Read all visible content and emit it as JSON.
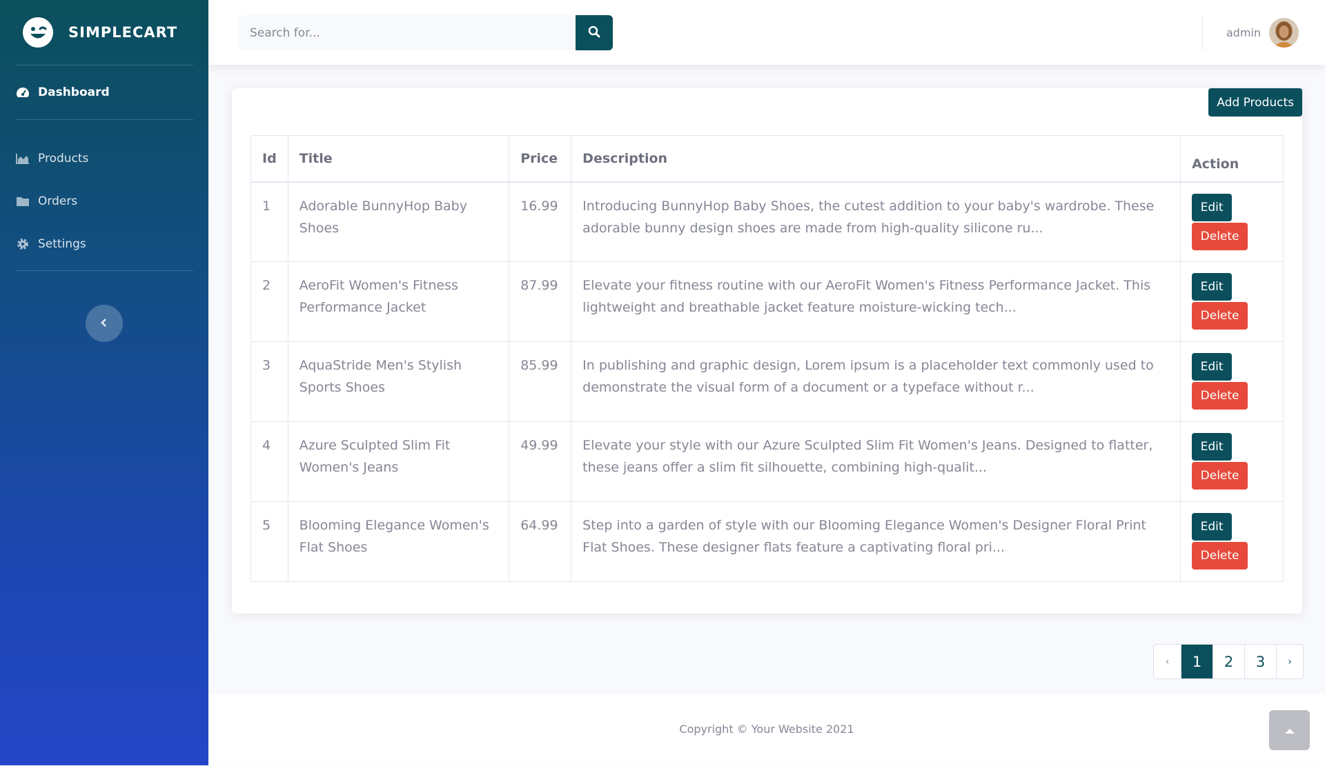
{
  "brand": {
    "name": "SIMPLECART",
    "logo_icon": "laugh-wink-icon"
  },
  "sidebar": {
    "items": [
      {
        "label": "Dashboard",
        "icon": "tachometer-icon",
        "active": true
      },
      {
        "label": "Products",
        "icon": "chart-area-icon",
        "active": false
      },
      {
        "label": "Orders",
        "icon": "folder-icon",
        "active": false
      },
      {
        "label": "Settings",
        "icon": "gear-icon",
        "active": false
      }
    ],
    "toggle_icon": "chevron-left-icon"
  },
  "topbar": {
    "search": {
      "placeholder": "Search for...",
      "value": ""
    },
    "user": {
      "name": "admin"
    }
  },
  "products": {
    "add_button": "Add Products",
    "columns": [
      "Id",
      "Title",
      "Price",
      "Description",
      "Action"
    ],
    "rows": [
      {
        "id": "1",
        "title": "Adorable BunnyHop Baby Shoes",
        "price": "16.99",
        "description": "Introducing BunnyHop Baby Shoes, the cutest addition to your baby's wardrobe. These adorable bunny design shoes are made from high-quality silicone ru..."
      },
      {
        "id": "2",
        "title": "AeroFit Women's Fitness Performance Jacket",
        "price": "87.99",
        "description": "Elevate your fitness routine with our AeroFit Women's Fitness Performance Jacket. This lightweight and breathable jacket feature moisture-wicking tech..."
      },
      {
        "id": "3",
        "title": "AquaStride Men's Stylish Sports Shoes",
        "price": "85.99",
        "description": "In publishing and graphic design, Lorem ipsum is a placeholder text commonly used to demonstrate the visual form of a document or a typeface without r..."
      },
      {
        "id": "4",
        "title": "Azure Sculpted Slim Fit Women's Jeans",
        "price": "49.99",
        "description": "Elevate your style with our Azure Sculpted Slim Fit Women's Jeans. Designed to flatter, these jeans offer a slim fit silhouette, combining high-qualit..."
      },
      {
        "id": "5",
        "title": "Blooming Elegance Women's Flat Shoes",
        "price": "64.99",
        "description": "Step into a garden of style with our Blooming Elegance Women's Designer Floral Print Flat Shoes. These designer flats feature a captivating floral pri..."
      }
    ],
    "edit_label": "Edit",
    "delete_label": "Delete"
  },
  "pagination": {
    "prev": "‹",
    "pages": [
      "1",
      "2",
      "3"
    ],
    "active": "1",
    "next": "›"
  },
  "footer": {
    "copyright": "Copyright © Your Website 2021"
  },
  "colors": {
    "primary": "#0b4f5c",
    "danger": "#e74a3b",
    "sidebar_top": "#0b4f5c",
    "sidebar_bottom": "#2346c6"
  }
}
